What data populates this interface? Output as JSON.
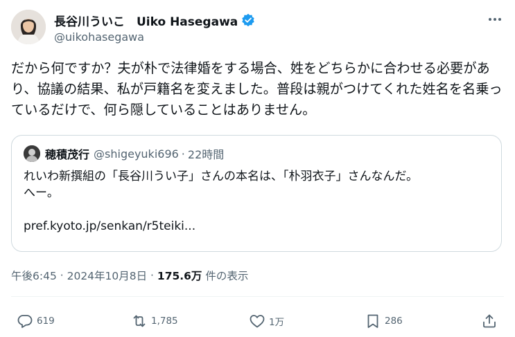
{
  "author": {
    "display_name": "長谷川ういこ　Uiko Hasegawa",
    "handle": "@uikohasegawa"
  },
  "colors": {
    "verified_badge": "#1d9bf0",
    "secondary_text": "#536471",
    "border": "#cfd9de"
  },
  "icons": {
    "verified": "verified-badge-icon",
    "more": "more-icon",
    "reply": "reply-icon",
    "repost": "repost-icon",
    "like": "like-icon",
    "bookmark": "bookmark-icon",
    "share": "share-icon"
  },
  "tweet": {
    "text": "だから何ですか？夫が朴で法律婚をする場合、姓をどちらかに合わせる必要があり、協議の結果、私が戸籍名を変えました。普段は親がつけてくれた姓名を名乗っているだけで、何ら隠していることはありません。"
  },
  "quoted": {
    "name": "穂積茂行",
    "handle": "@shigeyuki696",
    "separator": "·",
    "time": "22時間",
    "line1": "れいわ新撰組の「長谷川うい子」さんの本名は、「朴羽衣子」さんなんだ。",
    "line2": "へー。",
    "link": "pref.kyoto.jp/senkan/r5teiki..."
  },
  "meta": {
    "time": "午後6:45",
    "sep1": " · ",
    "date": "2024年10月8日",
    "sep2": " · ",
    "views": "175.6万",
    "views_label": " 件の表示"
  },
  "actions": {
    "replies": "619",
    "reposts": "1,785",
    "likes": "1万",
    "bookmarks": "286"
  }
}
